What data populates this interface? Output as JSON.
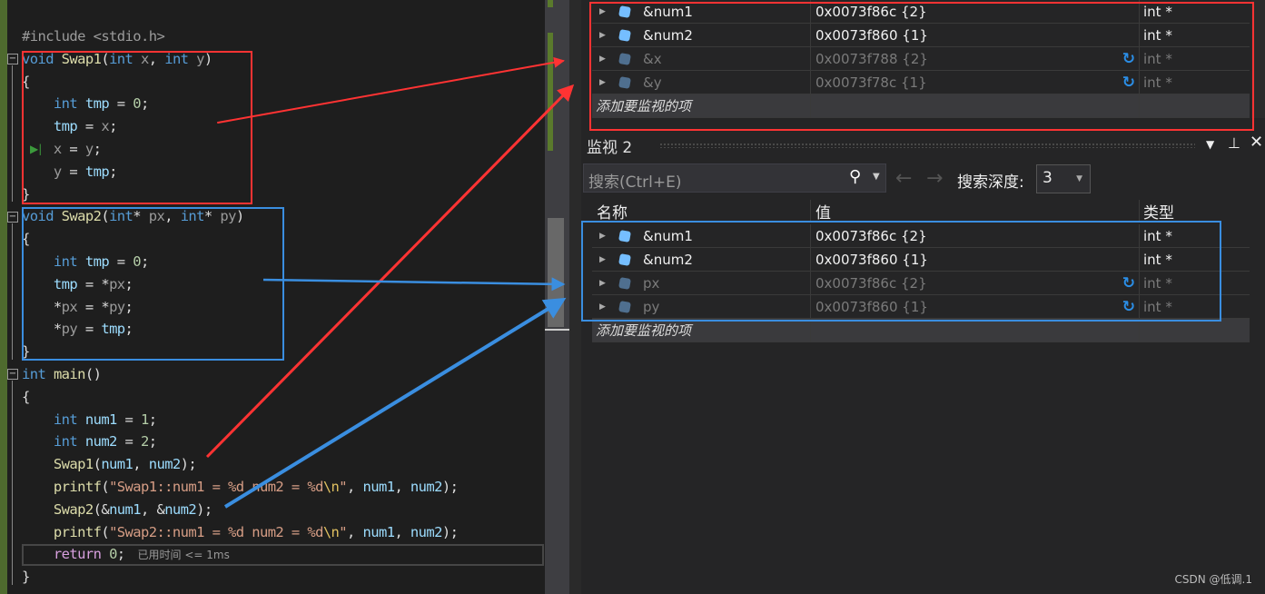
{
  "editor": {
    "lines": [
      [
        [
          "#include <stdio.h>",
          "pre"
        ]
      ],
      [
        [
          "void ",
          "kw"
        ],
        [
          "Swap1",
          "fn"
        ],
        [
          "(",
          "pl"
        ],
        [
          "int ",
          "kw"
        ],
        [
          "x",
          "par"
        ],
        [
          ", ",
          "pl"
        ],
        [
          "int ",
          "kw"
        ],
        [
          "y",
          "par"
        ],
        [
          ")",
          "pl"
        ]
      ],
      [
        [
          "{",
          "pl"
        ]
      ],
      [
        [
          "    int ",
          "kw"
        ],
        [
          "tmp",
          "var"
        ],
        [
          " = ",
          "pl"
        ],
        [
          "0",
          "num"
        ],
        [
          ";",
          "pl"
        ]
      ],
      [
        [
          "    tmp",
          "var"
        ],
        [
          " = ",
          "pl"
        ],
        [
          "x",
          "par"
        ],
        [
          ";",
          "pl"
        ]
      ],
      [
        [
          "    x",
          "par"
        ],
        [
          " = ",
          "pl"
        ],
        [
          "y",
          "par"
        ],
        [
          ";",
          "pl"
        ]
      ],
      [
        [
          "    y",
          "par"
        ],
        [
          " = ",
          "pl"
        ],
        [
          "tmp",
          "var"
        ],
        [
          ";",
          "pl"
        ]
      ],
      [
        [
          "}",
          "pl"
        ]
      ],
      [
        [
          "void ",
          "kw"
        ],
        [
          "Swap2",
          "fn"
        ],
        [
          "(",
          "pl"
        ],
        [
          "int",
          "kw"
        ],
        [
          "* ",
          "pl"
        ],
        [
          "px",
          "par"
        ],
        [
          ", ",
          "pl"
        ],
        [
          "int",
          "kw"
        ],
        [
          "* ",
          "pl"
        ],
        [
          "py",
          "par"
        ],
        [
          ")",
          "pl"
        ]
      ],
      [
        [
          "{",
          "pl"
        ]
      ],
      [
        [
          "    int ",
          "kw"
        ],
        [
          "tmp",
          "var"
        ],
        [
          " = ",
          "pl"
        ],
        [
          "0",
          "num"
        ],
        [
          ";",
          "pl"
        ]
      ],
      [
        [
          "    tmp",
          "var"
        ],
        [
          " = *",
          "pl"
        ],
        [
          "px",
          "par"
        ],
        [
          ";",
          "pl"
        ]
      ],
      [
        [
          "    *",
          "pl"
        ],
        [
          "px",
          "par"
        ],
        [
          " = *",
          "pl"
        ],
        [
          "py",
          "par"
        ],
        [
          ";",
          "pl"
        ]
      ],
      [
        [
          "    *",
          "pl"
        ],
        [
          "py",
          "par"
        ],
        [
          " = ",
          "pl"
        ],
        [
          "tmp",
          "var"
        ],
        [
          ";",
          "pl"
        ]
      ],
      [
        [
          "}",
          "pl"
        ]
      ],
      [
        [
          "int ",
          "kw"
        ],
        [
          "main",
          "fn"
        ],
        [
          "()",
          "pl"
        ]
      ],
      [
        [
          "{",
          "pl"
        ]
      ],
      [
        [
          "    int ",
          "kw"
        ],
        [
          "num1",
          "var"
        ],
        [
          " = ",
          "pl"
        ],
        [
          "1",
          "num"
        ],
        [
          ";",
          "pl"
        ]
      ],
      [
        [
          "    int ",
          "kw"
        ],
        [
          "num2",
          "var"
        ],
        [
          " = ",
          "pl"
        ],
        [
          "2",
          "num"
        ],
        [
          ";",
          "pl"
        ]
      ],
      [
        [
          "    Swap1",
          "fn"
        ],
        [
          "(",
          "pl"
        ],
        [
          "num1",
          "var"
        ],
        [
          ", ",
          "pl"
        ],
        [
          "num2",
          "var"
        ],
        [
          ");",
          "pl"
        ]
      ],
      [
        [
          "    printf",
          "fn"
        ],
        [
          "(",
          "pl"
        ],
        [
          "\"Swap1::num1 = %d num2 = %d",
          "str"
        ],
        [
          "\\n",
          "esc"
        ],
        [
          "\"",
          "str"
        ],
        [
          ", ",
          "pl"
        ],
        [
          "num1",
          "var"
        ],
        [
          ", ",
          "pl"
        ],
        [
          "num2",
          "var"
        ],
        [
          ");",
          "pl"
        ]
      ],
      [
        [
          "    Swap2",
          "fn"
        ],
        [
          "(&",
          "pl"
        ],
        [
          "num1",
          "var"
        ],
        [
          ", &",
          "pl"
        ],
        [
          "num2",
          "var"
        ],
        [
          ");",
          "pl"
        ]
      ],
      [
        [
          "    printf",
          "fn"
        ],
        [
          "(",
          "pl"
        ],
        [
          "\"Swap2::num1 = %d num2 = %d",
          "str"
        ],
        [
          "\\n",
          "esc"
        ],
        [
          "\"",
          "str"
        ],
        [
          ", ",
          "pl"
        ],
        [
          "num1",
          "var"
        ],
        [
          ", ",
          "pl"
        ],
        [
          "num2",
          "var"
        ],
        [
          ");",
          "pl"
        ]
      ],
      [
        [
          "    return ",
          "ret"
        ],
        [
          "0",
          "num"
        ],
        [
          ";",
          "pl"
        ]
      ],
      [
        [
          "}",
          "pl"
        ]
      ]
    ],
    "elapsed_hint": "已用时间 <= 1ms",
    "current_line": 23,
    "breakpoint_line": 5
  },
  "watch1": {
    "rows": [
      {
        "name": "&num1",
        "value": "0x0073f86c {2}",
        "type": "int *",
        "stale": false
      },
      {
        "name": "&num2",
        "value": "0x0073f860 {1}",
        "type": "int *",
        "stale": false
      },
      {
        "name": "&x",
        "value": "0x0073f788 {2}",
        "type": "int *",
        "stale": true
      },
      {
        "name": "&y",
        "value": "0x0073f78c {1}",
        "type": "int *",
        "stale": true
      }
    ],
    "add_item": "添加要监视的项"
  },
  "watch2": {
    "title": "监视 2",
    "search_placeholder": "搜索(Ctrl+E)",
    "depth_label": "搜索深度:",
    "depth_value": "3",
    "columns": [
      "名称",
      "值",
      "类型"
    ],
    "rows": [
      {
        "name": "&num1",
        "value": "0x0073f86c {2}",
        "type": "int *",
        "stale": false
      },
      {
        "name": "&num2",
        "value": "0x0073f860 {1}",
        "type": "int *",
        "stale": false
      },
      {
        "name": "px",
        "value": "0x0073f86c {2}",
        "type": "int *",
        "stale": true
      },
      {
        "name": "py",
        "value": "0x0073f860 {1}",
        "type": "int *",
        "stale": true
      }
    ],
    "add_item": "添加要监视的项"
  },
  "annotation_colors": {
    "red": "#ff3333",
    "blue": "#3a8ee0"
  },
  "watermark": "CSDN @低调.1"
}
